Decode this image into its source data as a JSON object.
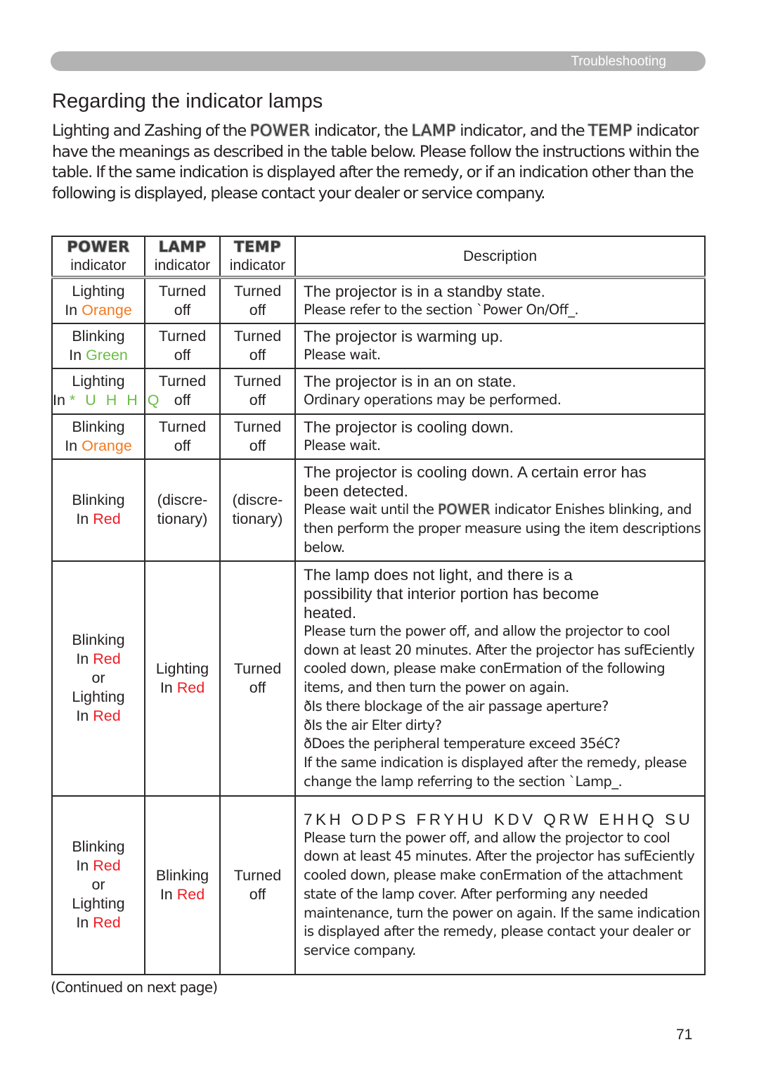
{
  "header": {
    "section_label": "Troubleshooting"
  },
  "page_title": "Regarding the indicator lamps",
  "intro": {
    "part1": "Lighting and Zashing of the ",
    "kw_power": "POWER",
    "part2": " indicator, the ",
    "kw_lamp": "LAMP",
    "part3": " indicator, and the ",
    "kw_temp": "TEMP",
    "part4": " indicator have the meanings as described in the table below. Please follow the instructions within the table. If the same indication is displayed after the remedy, or if an indication other than the following is displayed, please contact your dealer or service company."
  },
  "table": {
    "headers": {
      "power": {
        "keyword": "POWER",
        "label": "indicator"
      },
      "lamp": {
        "keyword": "LAMP",
        "label": "indicator"
      },
      "temp": {
        "keyword": "TEMP",
        "label": "indicator"
      },
      "description": "Description"
    },
    "colors": {
      "orange": "#f47a20",
      "green": "#6cbd45",
      "red": "#ed1c24"
    },
    "rows": [
      {
        "power": {
          "state": "Lighting",
          "prefix": "In ",
          "color_word": "Orange"
        },
        "lamp": {
          "line1": "Turned",
          "line2": "off"
        },
        "temp": {
          "line1": "Turned",
          "line2": "off"
        },
        "main": "The projector is in a standby state.",
        "sub": "Please refer to the section `Power On/Off_."
      },
      {
        "power": {
          "state": "Blinking",
          "prefix": "In ",
          "color_word": "Green"
        },
        "lamp": {
          "line1": "Turned",
          "line2": "off"
        },
        "temp": {
          "line1": "Turned",
          "line2": "off"
        },
        "main": "The projector is warming up.",
        "sub": "Please wait."
      },
      {
        "power": {
          "state": "Lighting",
          "prefix": "In ",
          "color_word": "* U H H Q"
        },
        "lamp": {
          "line1": "Turned",
          "line2": "off"
        },
        "temp": {
          "line1": "Turned",
          "line2": "off"
        },
        "main": "The projector is in an on state.",
        "sub": "Ordinary operations may be performed."
      },
      {
        "power": {
          "state": "Blinking",
          "prefix": "In ",
          "color_word": "Orange"
        },
        "lamp": {
          "line1": "Turned",
          "line2": "off"
        },
        "temp": {
          "line1": "Turned",
          "line2": "off"
        },
        "main": "The projector is cooling down.",
        "sub": "Please wait."
      },
      {
        "power": {
          "state": "Blinking",
          "prefix": "In ",
          "color_word": "Red"
        },
        "lamp": {
          "line1": "(discre-",
          "line2": "tionary)"
        },
        "temp": {
          "line1": "(discre-",
          "line2": "tionary)"
        },
        "main": "The projector is cooling down. A certain error has been detected.",
        "sub_part1": "Please wait until the ",
        "sub_kw": "POWER",
        "sub_part2": " indicator Enishes blinking, and then perform the proper measure using the item descriptions below."
      },
      {
        "power": {
          "state1": "Blinking",
          "prefix1": "In ",
          "color_word1": "Red",
          "or": "or",
          "state2": "Lighting",
          "prefix2": "In ",
          "color_word2": "Red"
        },
        "lamp": {
          "state": "Lighting",
          "prefix": "In ",
          "color_word": "Red"
        },
        "temp": {
          "line1": "Turned",
          "line2": "off"
        },
        "main": "The lamp does not light, and there is a possibility that interior portion has become heated.",
        "sub_lines": [
          "Please turn the power off, and allow the projector to cool down at least 20 minutes. After the projector has sufEciently cooled down, please make conErmation of the following items, and then turn the power on again.",
          "ðIs there blockage of the air passage aperture?",
          "ðIs the air Elter dirty?",
          "ðDoes the peripheral temperature exceed 35éC?",
          "If the same indication is displayed after the remedy, please change the lamp referring to the section `Lamp_."
        ]
      },
      {
        "power": {
          "state1": "Blinking",
          "prefix1": "In ",
          "color_word1": "Red",
          "or": "or",
          "state2": "Lighting",
          "prefix2": "In ",
          "color_word2": "Red"
        },
        "lamp": {
          "state": "Blinking",
          "prefix": "In ",
          "color_word": "Red"
        },
        "temp": {
          "line1": "Turned",
          "line2": "off"
        },
        "main_garbled": "7KH ODPS FRYHU KDV QRW EHHQ SU",
        "sub": "Please turn the power off, and allow the projector to cool down at least 45 minutes. After the projector has sufEciently cooled down, please make conErmation of the attachment state of the lamp cover. After performing any needed maintenance, turn the power on again. If the same indication is displayed after the remedy, please contact your dealer or service company."
      }
    ]
  },
  "footer": {
    "continued": "(Continued on next page)",
    "page_number": "71"
  }
}
